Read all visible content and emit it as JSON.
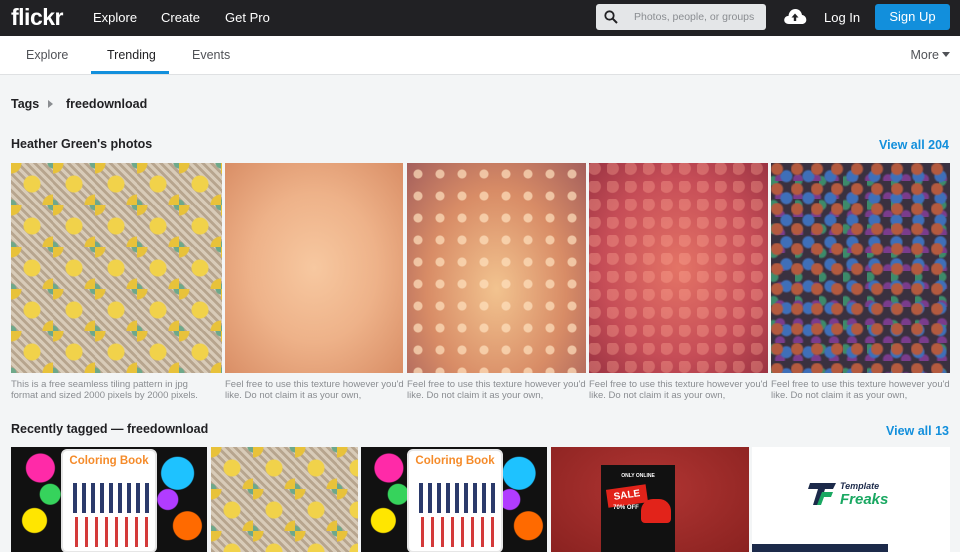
{
  "brand": {
    "logo": "flickr"
  },
  "topnav": {
    "explore": "Explore",
    "create": "Create",
    "get_pro": "Get Pro"
  },
  "search": {
    "placeholder": "Photos, people, or groups"
  },
  "auth": {
    "login": "Log In",
    "signup": "Sign Up"
  },
  "subnav": {
    "tabs": [
      {
        "label": "Explore"
      },
      {
        "label": "Trending",
        "active": true
      },
      {
        "label": "Events"
      }
    ],
    "more": "More"
  },
  "breadcrumb": {
    "root": "Tags",
    "tag": "freedownload"
  },
  "section1": {
    "title": "Heather Green's photos",
    "view_all": "View all 204",
    "photos": [
      {
        "caption": "This is a free seamless tiling pattern in jpg format and sized 2000 pixels by 2000 pixels."
      },
      {
        "caption": "Feel free to use this texture however you'd like. Do not claim it as your own,"
      },
      {
        "caption": "Feel free to use this texture however you'd like. Do not claim it as your own,"
      },
      {
        "caption": "Feel free to use this texture however you'd like. Do not claim it as your own,"
      },
      {
        "caption": "Feel free to use this texture however you'd like. Do not claim it as your own,"
      }
    ]
  },
  "section2": {
    "title": "Recently tagged — freedownload",
    "view_all": "View all 13",
    "photos": [
      {
        "book_title": "Coloring Book"
      },
      {},
      {
        "book_title": "Coloring Book"
      },
      {
        "poster_top": "ONLY ONLINE",
        "sale": "SALE",
        "off": "70% OFF"
      },
      {
        "template": "Template",
        "freaks": "Freaks"
      }
    ]
  },
  "colors": {
    "accent": "#128fdc",
    "topbar": "#212124",
    "background": "#f3f5f6"
  },
  "icons": {
    "search": "search-icon",
    "upload": "cloud-upload-icon",
    "breadcrumb_arrow": "chevron-right-icon",
    "more": "caret-down-icon"
  }
}
